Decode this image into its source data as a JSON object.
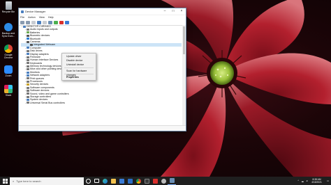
{
  "desktop": {
    "icons": [
      {
        "label": "Recycle Bin"
      },
      {
        "label": "Backup and Sync from..."
      },
      {
        "label": "Google Chrome"
      },
      {
        "label": "Zoom"
      },
      {
        "label": "Slack"
      }
    ]
  },
  "window": {
    "title": "Device Manager",
    "menu": [
      "File",
      "Action",
      "View",
      "Help"
    ],
    "tree": [
      {
        "label": "DESKTOP-C4RH4K3",
        "indent": 0,
        "exp": "⌄",
        "color": "#4b7fbf"
      },
      {
        "label": "Audio inputs and outputs",
        "indent": 1,
        "exp": "›",
        "color": "#7a7a7a"
      },
      {
        "label": "Batteries",
        "indent": 1,
        "exp": "›",
        "color": "#6aa84f"
      },
      {
        "label": "Biometric devices",
        "indent": 1,
        "exp": "›",
        "color": "#555555"
      },
      {
        "label": "Bluetooth",
        "indent": 1,
        "exp": "›",
        "color": "#2b7cd3"
      },
      {
        "label": "Cameras",
        "indent": 1,
        "exp": "⌄",
        "color": "#555555"
      },
      {
        "label": "Integrated Webcam",
        "indent": 2,
        "exp": "",
        "color": "#555555",
        "selected": true
      },
      {
        "label": "Computer",
        "indent": 1,
        "exp": "›",
        "color": "#4b7fbf"
      },
      {
        "label": "Disk drives",
        "indent": 1,
        "exp": "›",
        "color": "#777777"
      },
      {
        "label": "Display adapters",
        "indent": 1,
        "exp": "›",
        "color": "#4b7fbf"
      },
      {
        "label": "Firmware",
        "indent": 1,
        "exp": "›",
        "color": "#777777"
      },
      {
        "label": "Human Interface Devices",
        "indent": 1,
        "exp": "›",
        "color": "#777777"
      },
      {
        "label": "Keyboards",
        "indent": 1,
        "exp": "›",
        "color": "#777777"
      },
      {
        "label": "Memory technology devices",
        "indent": 1,
        "exp": "›",
        "color": "#777777"
      },
      {
        "label": "Mice and other pointing devices",
        "indent": 1,
        "exp": "›",
        "color": "#777777"
      },
      {
        "label": "Monitors",
        "indent": 1,
        "exp": "›",
        "color": "#4b7fbf"
      },
      {
        "label": "Network adapters",
        "indent": 1,
        "exp": "›",
        "color": "#4b7fbf"
      },
      {
        "label": "Print queues",
        "indent": 1,
        "exp": "›",
        "color": "#777777"
      },
      {
        "label": "Processors",
        "indent": 1,
        "exp": "›",
        "color": "#777777"
      },
      {
        "label": "Security devices",
        "indent": 1,
        "exp": "›",
        "color": "#c9a227"
      },
      {
        "label": "Software components",
        "indent": 1,
        "exp": "›",
        "color": "#777777"
      },
      {
        "label": "Software devices",
        "indent": 1,
        "exp": "›",
        "color": "#777777"
      },
      {
        "label": "Sound, video and game controllers",
        "indent": 1,
        "exp": "›",
        "color": "#777777"
      },
      {
        "label": "Storage controllers",
        "indent": 1,
        "exp": "›",
        "color": "#777777"
      },
      {
        "label": "System devices",
        "indent": 1,
        "exp": "›",
        "color": "#4b7fbf"
      },
      {
        "label": "Universal Serial Bus controllers",
        "indent": 1,
        "exp": "›",
        "color": "#777777"
      }
    ]
  },
  "context_menu": {
    "items": [
      {
        "label": "Update driver",
        "bold": false
      },
      {
        "label": "Disable device",
        "bold": false
      },
      {
        "label": "Uninstall device",
        "bold": false
      },
      {
        "sep": true
      },
      {
        "label": "Scan for hardware changes",
        "bold": false
      },
      {
        "sep": true
      },
      {
        "label": "Properties",
        "bold": true
      }
    ]
  },
  "taskbar": {
    "search_placeholder": "Type here to search",
    "time": "8:38 AM",
    "date": "4/15/2021"
  },
  "colors": {
    "flower_petal": "#b3202e",
    "flower_center": "#9cc33b",
    "taskbar": "#1f1f1f"
  }
}
